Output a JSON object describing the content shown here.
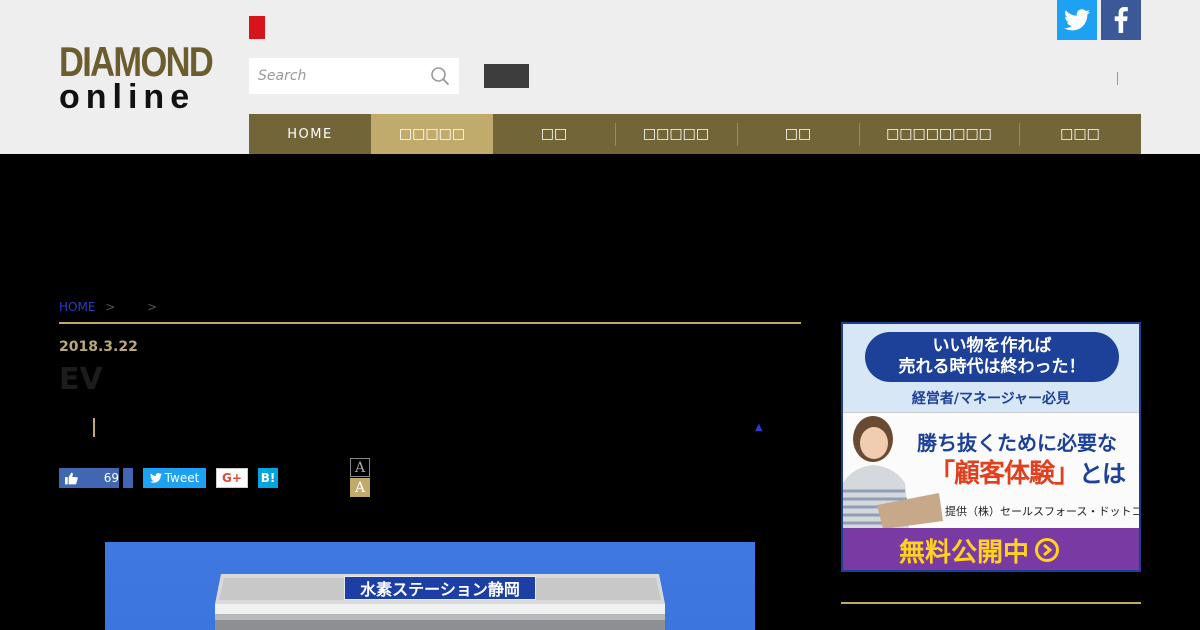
{
  "logo": {
    "line1": "DIAMOND",
    "line2": "online"
  },
  "search": {
    "placeholder": "Search"
  },
  "colors": {
    "nav_bg": "#726538",
    "nav_active": "#c1ab6c",
    "accent_red": "#d7141b",
    "twitter": "#1da1f2",
    "facebook": "#3b5998"
  },
  "social_top": [
    {
      "icon": "twitter-icon"
    },
    {
      "icon": "facebook-icon"
    }
  ],
  "nav": [
    {
      "label": "HOME"
    },
    {
      "label": "□□□□□"
    },
    {
      "label": "□□"
    },
    {
      "label": "□□□□□"
    },
    {
      "label": "□□"
    },
    {
      "label": "□□□□□□□□"
    },
    {
      "label": "□□□"
    }
  ],
  "breadcrumb": {
    "home": "HOME",
    "sep1": ">",
    "sep2": ">"
  },
  "article": {
    "date": "2018.3.22",
    "title": "EV",
    "like_count": "69",
    "tweet_label": "Tweet",
    "gplus_label": "G+",
    "hatena_label": "B!",
    "font_small": "A",
    "font_large": "A",
    "photo_sign": "水素ステーション静岡"
  },
  "ad": {
    "pill_line1": "いい物を作れば",
    "pill_line2": "売れる時代は終わった！",
    "sub": "経営者/マネージャー必見",
    "headline1": "勝ち抜くために必要な",
    "headline2": "「顧客体験」",
    "headline2_suffix": "とは",
    "credit": "提供（株）セールスフォース・ドットコム",
    "cta": "無料公開中"
  }
}
